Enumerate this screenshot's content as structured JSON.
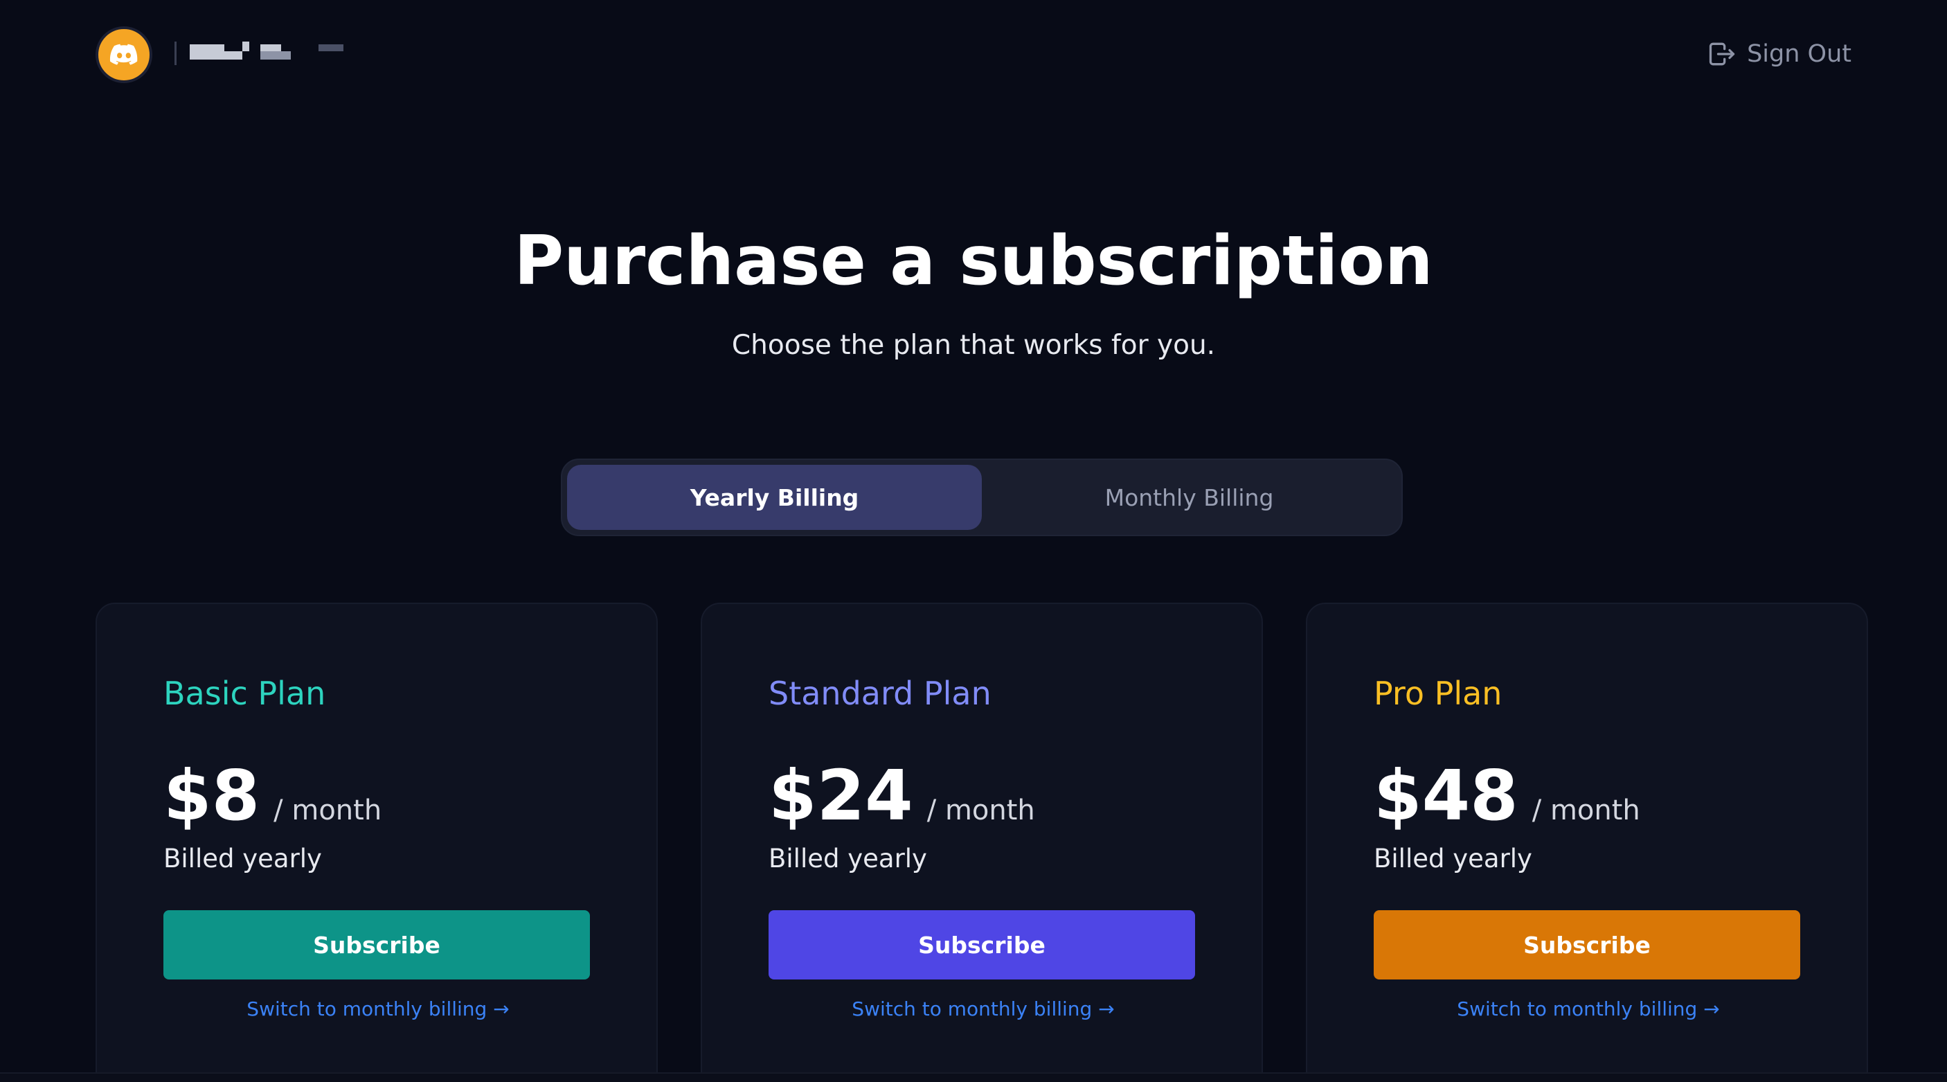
{
  "header": {
    "signout_label": "Sign Out",
    "logo_icon": "discord-icon",
    "signout_icon": "sign-out-icon"
  },
  "hero": {
    "title": "Purchase a subscription",
    "subtitle": "Choose the plan that works for you."
  },
  "billing_toggle": {
    "options": [
      "Yearly Billing",
      "Monthly Billing"
    ],
    "selected": "Yearly Billing"
  },
  "plans": [
    {
      "name": "Basic Plan",
      "price": "$8",
      "period": "/ month",
      "billed": "Billed yearly",
      "button": "Subscribe",
      "link": "Switch to monthly billing →",
      "name_color": "#2dd4bf",
      "button_color": "#0d9488"
    },
    {
      "name": "Standard Plan",
      "price": "$24",
      "period": "/ month",
      "billed": "Billed yearly",
      "button": "Subscribe",
      "link": "Switch to monthly billing →",
      "name_color": "#818cf8",
      "button_color": "#4f46e5"
    },
    {
      "name": "Pro Plan",
      "price": "$48",
      "period": "/ month",
      "billed": "Billed yearly",
      "button": "Subscribe",
      "link": "Switch to monthly billing →",
      "name_color": "#fbbf24",
      "button_color": "#d97706"
    }
  ],
  "colors": {
    "background": "#080b17",
    "card": "#0e1220",
    "toggle_active": "#373b6b",
    "link": "#3b82f6",
    "logo": "#f5a524"
  }
}
